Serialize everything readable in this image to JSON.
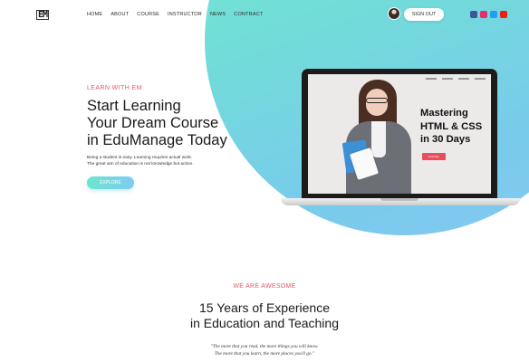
{
  "header": {
    "logo": "EM",
    "nav": [
      "HOME",
      "ABOUT",
      "COURSE",
      "INSTRUCTOR",
      "NEWS",
      "CONTRACT"
    ],
    "signout_label": "SIGN OUT",
    "socials": [
      {
        "icon": "facebook-icon",
        "color": "#3b5998"
      },
      {
        "icon": "instagram-icon",
        "color": "#e1306c"
      },
      {
        "icon": "twitter-icon",
        "color": "#1da1f2"
      },
      {
        "icon": "youtube-icon",
        "color": "#e62117"
      }
    ]
  },
  "hero": {
    "kicker": "LEARN WITH EM",
    "title_lines": [
      "Start Learning",
      "Your Dream Course",
      "in EduManage Today"
    ],
    "desc_lines": [
      "Being a student is easy. Learning requires actual work.",
      "The great aim of education is not knowledge but action."
    ],
    "explore_label": "EXPLORE"
  },
  "promo": {
    "title_lines": [
      "Mastering",
      "HTML & CSS",
      "in 30 Days"
    ],
    "button_label": "Enroll Now"
  },
  "section2": {
    "kicker": "WE ARE AWESOME",
    "title_lines": [
      "15 Years of Experience",
      "in Education and Teaching"
    ],
    "quote_lines": [
      "\"The more that you read, the more things you will know.",
      "The more that you learn, the more places you'll go.\""
    ]
  },
  "colors": {
    "accent": "#e55a6b",
    "gradient_start": "#6ee5cf",
    "gradient_end": "#86c7f2"
  }
}
